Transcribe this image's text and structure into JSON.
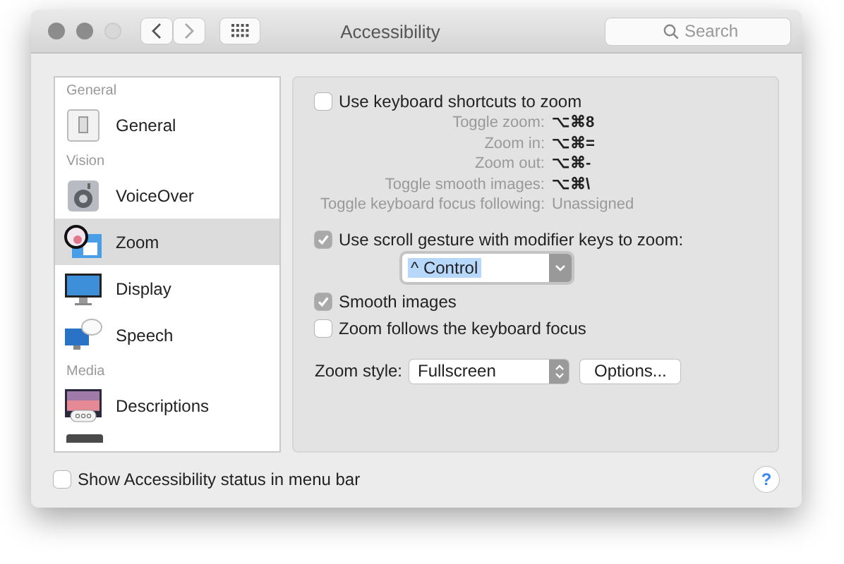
{
  "window": {
    "title": "Accessibility",
    "search": {
      "placeholder": "Search"
    }
  },
  "sidebar": {
    "items": [
      {
        "kind": "header",
        "label": "General"
      },
      {
        "kind": "item",
        "label": "General",
        "selected": false
      },
      {
        "kind": "header",
        "label": "Vision"
      },
      {
        "kind": "item",
        "label": "VoiceOver",
        "selected": false
      },
      {
        "kind": "item",
        "label": "Zoom",
        "selected": true
      },
      {
        "kind": "item",
        "label": "Display",
        "selected": false
      },
      {
        "kind": "item",
        "label": "Speech",
        "selected": false
      },
      {
        "kind": "header",
        "label": "Media"
      },
      {
        "kind": "item",
        "label": "Descriptions",
        "selected": false
      },
      {
        "kind": "partial",
        "selected": false
      }
    ]
  },
  "panel": {
    "keyboard_shortcuts": {
      "label": "Use keyboard shortcuts to zoom",
      "checked": false
    },
    "shortcuts": [
      {
        "label": "Toggle zoom:",
        "value": "⌥⌘8",
        "assigned": true
      },
      {
        "label": "Zoom in:",
        "value": "⌥⌘=",
        "assigned": true
      },
      {
        "label": "Zoom out:",
        "value": "⌥⌘-",
        "assigned": true
      },
      {
        "label": "Toggle smooth images:",
        "value": "⌥⌘\\",
        "assigned": true
      },
      {
        "label": "Toggle keyboard focus following:",
        "value": "Unassigned",
        "assigned": false
      }
    ],
    "scroll_gesture": {
      "label": "Use scroll gesture with modifier keys to zoom:",
      "checked": true,
      "disabled": true
    },
    "modifier_dropdown": {
      "value": "^ Control"
    },
    "options": [
      {
        "label": "Smooth images",
        "checked": true,
        "disabled": true
      },
      {
        "label": "Zoom follows the keyboard focus",
        "checked": false,
        "disabled": false
      }
    ],
    "zoom_style": {
      "label": "Zoom style:",
      "value": "Fullscreen"
    },
    "options_button": "Options..."
  },
  "footer": {
    "status_checkbox": {
      "label": "Show Accessibility status in menu bar",
      "checked": false
    },
    "help": "?"
  }
}
